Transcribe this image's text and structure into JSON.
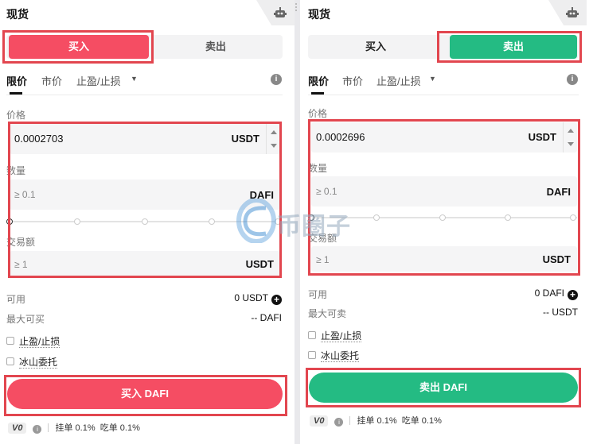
{
  "colors": {
    "buy": "#f54d63",
    "sell": "#24bb83",
    "highlight": "#e2464f"
  },
  "left": {
    "title": "现货",
    "side_tabs": {
      "buy": "买入",
      "sell": "卖出",
      "active": "buy"
    },
    "order_tabs": {
      "limit": "限价",
      "market": "市价",
      "tpsl": "止盈/止损"
    },
    "price": {
      "label": "价格",
      "value": "0.0002703",
      "unit": "USDT"
    },
    "amount": {
      "label": "数量",
      "placeholder": "≥ 0.1",
      "unit": "DAFI"
    },
    "total": {
      "label": "交易额",
      "placeholder": "≥ 1",
      "unit": "USDT"
    },
    "available": {
      "label": "可用",
      "value": "0 USDT"
    },
    "max": {
      "label": "最大可买",
      "value": "-- DAFI"
    },
    "options": [
      "止盈/止损",
      "冰山委托"
    ],
    "submit": "买入 DAFI",
    "footer": {
      "vip": "V0",
      "maker": "挂单 0.1%",
      "taker": "吃单 0.1%"
    }
  },
  "right": {
    "title": "现货",
    "side_tabs": {
      "buy": "买入",
      "sell": "卖出",
      "active": "sell"
    },
    "order_tabs": {
      "limit": "限价",
      "market": "市价",
      "tpsl": "止盈/止损"
    },
    "price": {
      "label": "价格",
      "value": "0.0002696",
      "unit": "USDT"
    },
    "amount": {
      "label": "数量",
      "placeholder": "≥ 0.1",
      "unit": "DAFI"
    },
    "total": {
      "label": "交易额",
      "placeholder": "≥ 1",
      "unit": "USDT"
    },
    "available": {
      "label": "可用",
      "value": "0 DAFI"
    },
    "max": {
      "label": "最大可卖",
      "value": "-- USDT"
    },
    "options": [
      "止盈/止损",
      "冰山委托"
    ],
    "submit": "卖出 DAFI",
    "footer": {
      "vip": "V0",
      "maker": "挂单 0.1%",
      "taker": "吃单 0.1%"
    }
  },
  "watermark": "币圈子",
  "icons": {
    "bot": "robot-icon",
    "info": "info-icon",
    "add": "plus-circle-icon",
    "dropdown": "caret-down-icon"
  }
}
